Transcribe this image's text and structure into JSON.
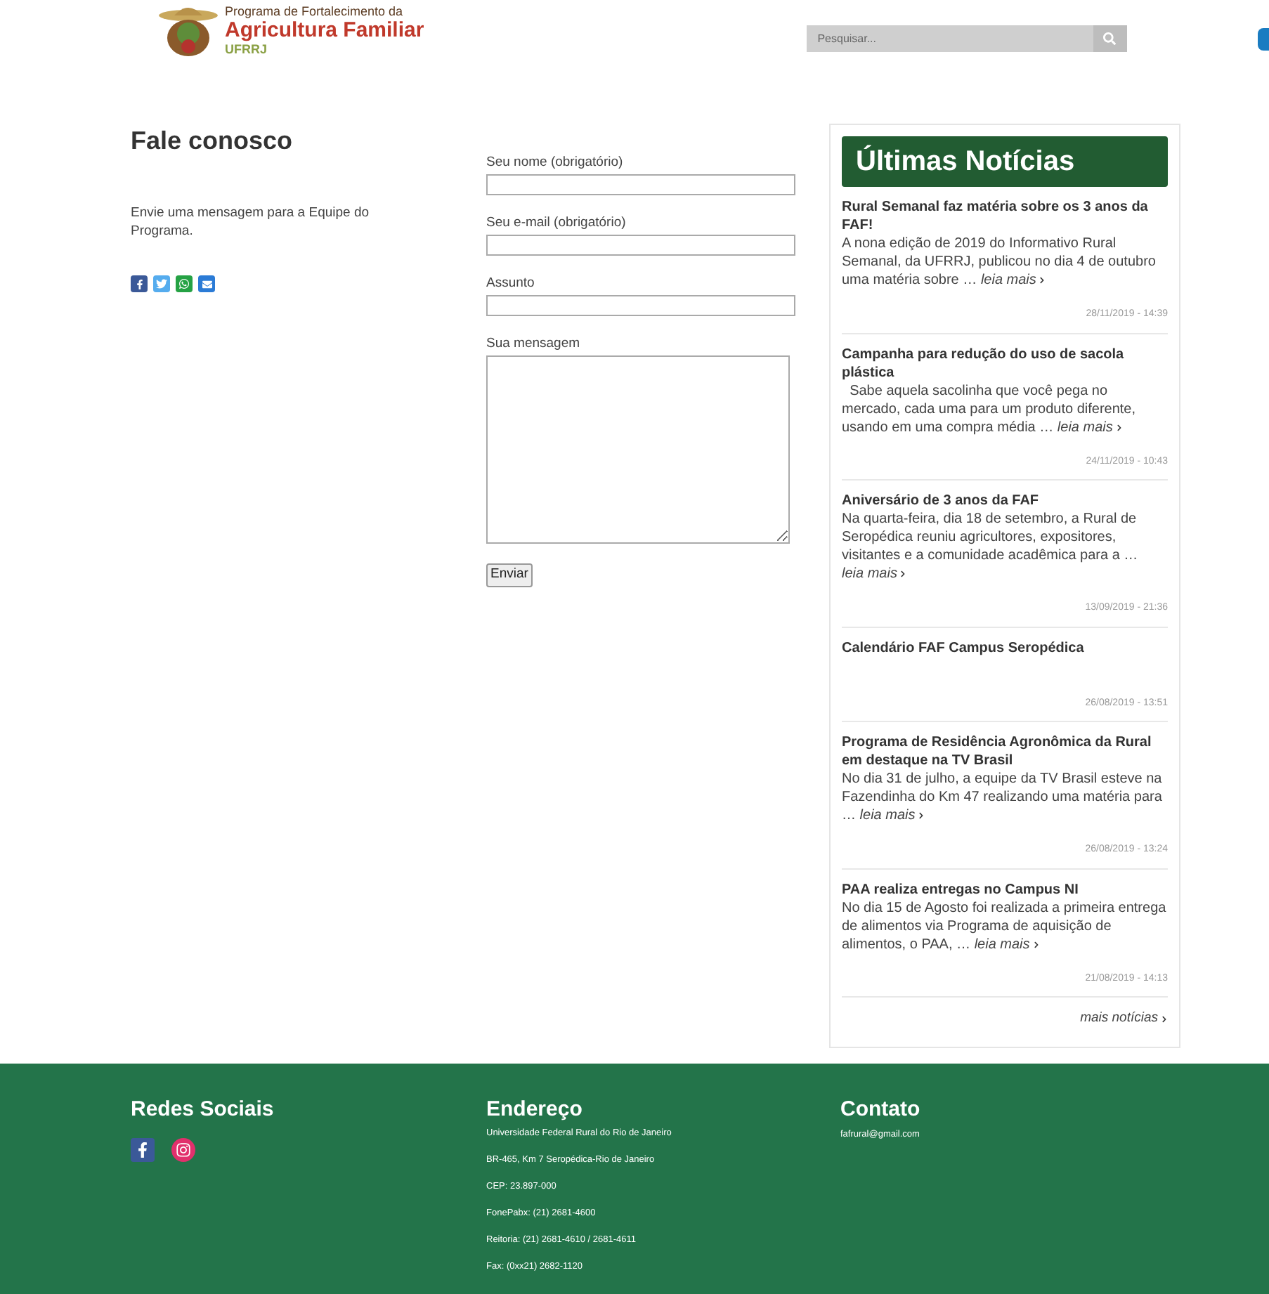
{
  "header": {
    "logo": {
      "line_1": "Programa de Fortalecimento da",
      "line_2": "Agricultura Familiar",
      "line_3": "UFRRJ"
    },
    "search": {
      "placeholder": "Pesquisar..."
    }
  },
  "contact": {
    "title": "Fale conosco",
    "intro": "Envie uma mensagem para a Equipe do Programa."
  },
  "form": {
    "fields": [
      {
        "label": "Seu nome (obrigatório)",
        "kind": "text"
      },
      {
        "label": "Seu e-mail (obrigatório)",
        "kind": "text"
      },
      {
        "label": "Assunto",
        "kind": "text"
      },
      {
        "label": "Sua mensagem",
        "kind": "textarea"
      }
    ],
    "submit": "Enviar"
  },
  "news": {
    "title": "Últimas Notícias",
    "items": [
      {
        "title": "Rural Semanal faz matéria sobre os 3 anos da FAF!",
        "body": "A nona edição de 2019 do Informativo Rural Semanal, da UFRRJ, publicou no dia 4 de outubro uma matéria sobre …",
        "more": "leia mais",
        "date": "28/11/2019 - 14:39"
      },
      {
        "title": "Campanha para redução do uso de sacola plástica",
        "body": "  Sabe aquela sacolinha que você pega no mercado, cada uma para um produto diferente, usando em uma compra média …",
        "more": "leia mais",
        "date": "24/11/2019 - 10:43"
      },
      {
        "title": "Aniversário de 3 anos da FAF",
        "body": "Na quarta-feira, dia 18 de setembro, a Rural de Seropédica reuniu agricultores, expositores, visitantes e a comunidade acadêmica para a …",
        "more": "leia mais",
        "date": "13/09/2019 - 21:36"
      },
      {
        "title": "Calendário FAF Campus Seropédica",
        "date": "26/08/2019 - 13:51"
      },
      {
        "title": "Programa de Residência Agronômica da Rural em destaque na TV Brasil",
        "body": "No dia 31 de julho, a equipe da TV Brasil esteve na Fazendinha do Km 47 realizando uma matéria para …",
        "more": "leia mais",
        "date": "26/08/2019 - 13:24"
      },
      {
        "title": "PAA realiza entregas no Campus NI",
        "body": "No dia 15 de Agosto foi realizada a primeira entrega de alimentos via Programa de aquisição de alimentos, o PAA, …",
        "more": "leia mais",
        "date": "21/08/2019 - 14:13"
      }
    ],
    "more_link": "mais notícias"
  },
  "footer": {
    "social": {
      "title": "Redes Sociais"
    },
    "address": {
      "title": "Endereço",
      "lines": [
        "Universidade Federal Rural do Rio de Janeiro",
        "BR-465, Km 7 Seropédica-Rio de Janeiro",
        "CEP: 23.897-000",
        "FonePabx: (21) 2681-4600",
        "Reitoria: (21) 2681-4610 / 2681-4611",
        "Fax: (0xx21) 2682-1120"
      ]
    },
    "contact": {
      "title": "Contato",
      "email": "fafrural@gmail.com"
    }
  }
}
